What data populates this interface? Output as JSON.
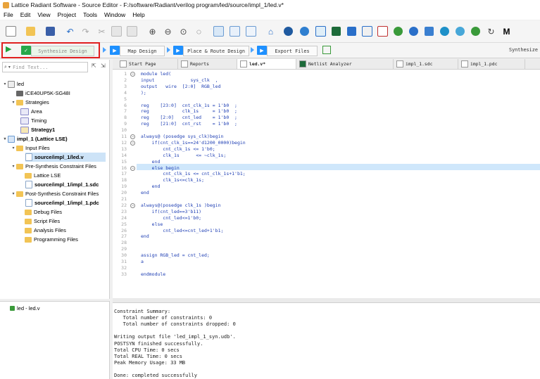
{
  "window": {
    "title": "Lattice Radiant Software - Source Editor - F:/software/Radiant/verilog program/led/source/impl_1/led.v*"
  },
  "menu": [
    "File",
    "Edit",
    "View",
    "Project",
    "Tools",
    "Window",
    "Help"
  ],
  "flow": {
    "steps": [
      "Synthesize Design",
      "Map Design",
      "Place & Route Design",
      "Export Files"
    ],
    "right_label": "Synthesize D"
  },
  "left": {
    "find_placeholder": "Find Text...",
    "tree": [
      "led",
      "iCE40UP5K-SG48I",
      "Strategies",
      "Area",
      "Timing",
      "Strategy1",
      "impl_1 (Lattice LSE)",
      "Input Files",
      "source/impl_1/led.v",
      "Pre-Synthesis Constraint Files",
      "Lattice LSE",
      "source/impl_1/impl_1.sdc",
      "Post-Synthesis Constraint Files",
      "source/impl_1/impl_1.pdc",
      "Debug Files",
      "Script Files",
      "Analysis Files",
      "Programming Files"
    ],
    "bottom_item": "led - led.v"
  },
  "tabs": [
    "Start Page",
    "Reports",
    "led.v*",
    "Netlist Analyzer",
    "impl_1.sdc",
    "impl_1.pdc"
  ],
  "editor": {
    "lines": [
      "module led(",
      "input             sys_clk  ,",
      "output   wire  [2:0]  RGB_led",
      ");",
      "",
      "reg    [23:0]  cnt_clk_1s = 1'b0  ;",
      "reg            clk_1s     = 1'b0  ;",
      "reg    [2:0]   cnt_led    = 1'b0  ;",
      "reg    [21:0]  cnt_rst    = 1'b0  ;",
      "",
      "always@ (posedge sys_clk)begin",
      "    if(cnt_clk_1s==24'd1200_0000)begin",
      "        cnt_clk_1s <= 1'b0;",
      "        clk_1s      <= ~clk_1s;",
      "    end",
      "    else begin",
      "        cnt_clk_1s <= cnt_clk_1s+1'b1;",
      "        clk_1s<=clk_1s;",
      "    end",
      "end",
      "",
      "always@(posedge clk_1s )begin",
      "    if(cnt_led==3'b11)",
      "        cnt_led<=1'b0;",
      "    else",
      "        cnt_led<=cnt_led+1'b1;",
      "end",
      "",
      "",
      "assign RGB_led = cnt_led;",
      "a",
      "",
      "endmodule"
    ]
  },
  "console": [
    "Constraint Summary:",
    "   Total number of constraints: 0",
    "   Total number of constraints dropped: 0",
    "",
    "Writing output file 'led_impl_1_syn.udb'.",
    "POSTSYN finished successfully.",
    "Total CPU Time: 0 secs",
    "Total REAL Time: 0 secs",
    "Peak Memory Usage: 33 MB",
    "",
    "Done: completed successfully"
  ]
}
